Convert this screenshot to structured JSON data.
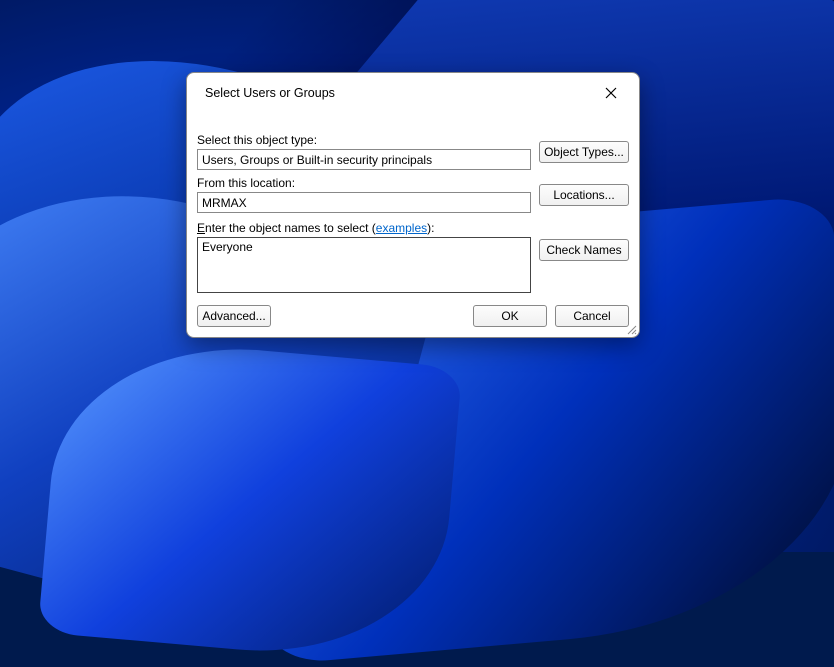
{
  "dialog": {
    "title": "Select Users or Groups",
    "object_type": {
      "label": "Select this object type:",
      "value": "Users, Groups or Built-in security principals",
      "button": "Object Types..."
    },
    "location": {
      "label": "From this location:",
      "value": "MRMAX",
      "button": "Locations..."
    },
    "names": {
      "label_prefix": "Enter the object names to select (",
      "link_text": "examples",
      "label_suffix": "):",
      "value": "Everyone",
      "button": "Check Names"
    },
    "buttons": {
      "advanced": "Advanced...",
      "ok": "OK",
      "cancel": "Cancel"
    }
  }
}
